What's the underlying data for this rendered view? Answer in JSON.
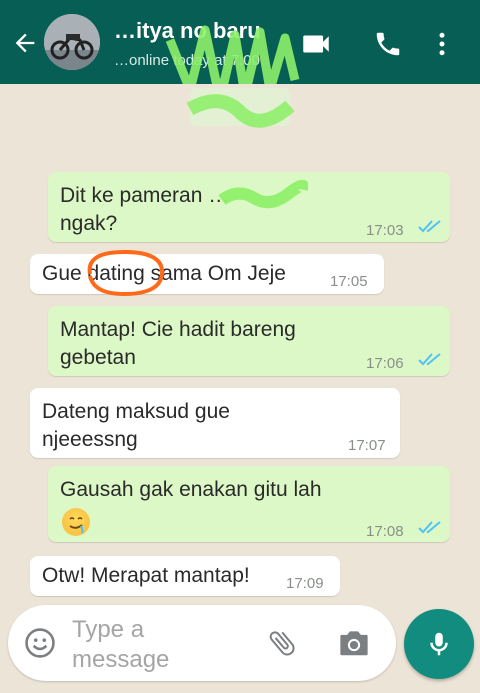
{
  "header": {
    "contact_name": "…itya no baru",
    "status": "…online today at 7:00",
    "background_color": "#075e54"
  },
  "messages": [
    {
      "direction": "outgoing",
      "text": "Dit ke pameran …\nngak?",
      "time": "17:03",
      "read": true
    },
    {
      "direction": "incoming",
      "text": "Gue dating sama Om Jeje",
      "time": "17:05"
    },
    {
      "direction": "outgoing",
      "text": "Mantap! Cie hadit bareng\ngebetan",
      "time": "17:06",
      "read": true
    },
    {
      "direction": "incoming",
      "text": "Dateng maksud gue\nnjeeessng",
      "time": "17:07"
    },
    {
      "direction": "outgoing",
      "text": "Gausah gak enakan gitu lah",
      "emoji": "drooling-face",
      "time": "17:08",
      "read": true
    },
    {
      "direction": "incoming",
      "text": "Otw! Merapat mantap!",
      "time": "17:09"
    }
  ],
  "input": {
    "placeholder": "Type a\nmessage"
  },
  "icons": {
    "back": "arrow-left-icon",
    "video": "video-call-icon",
    "call": "phone-icon",
    "menu": "more-vert-icon",
    "emoji": "smiley-icon",
    "attach": "paperclip-icon",
    "camera": "camera-icon",
    "mic": "microphone-icon"
  },
  "colors": {
    "outgoing_bubble": "#dcf8c6",
    "incoming_bubble": "#ffffff",
    "read_ticks": "#4fc3f7",
    "mic_button": "#128c7e",
    "highlight_circle": "#ff6a1a",
    "redaction_scribble": "#8ef06a"
  }
}
